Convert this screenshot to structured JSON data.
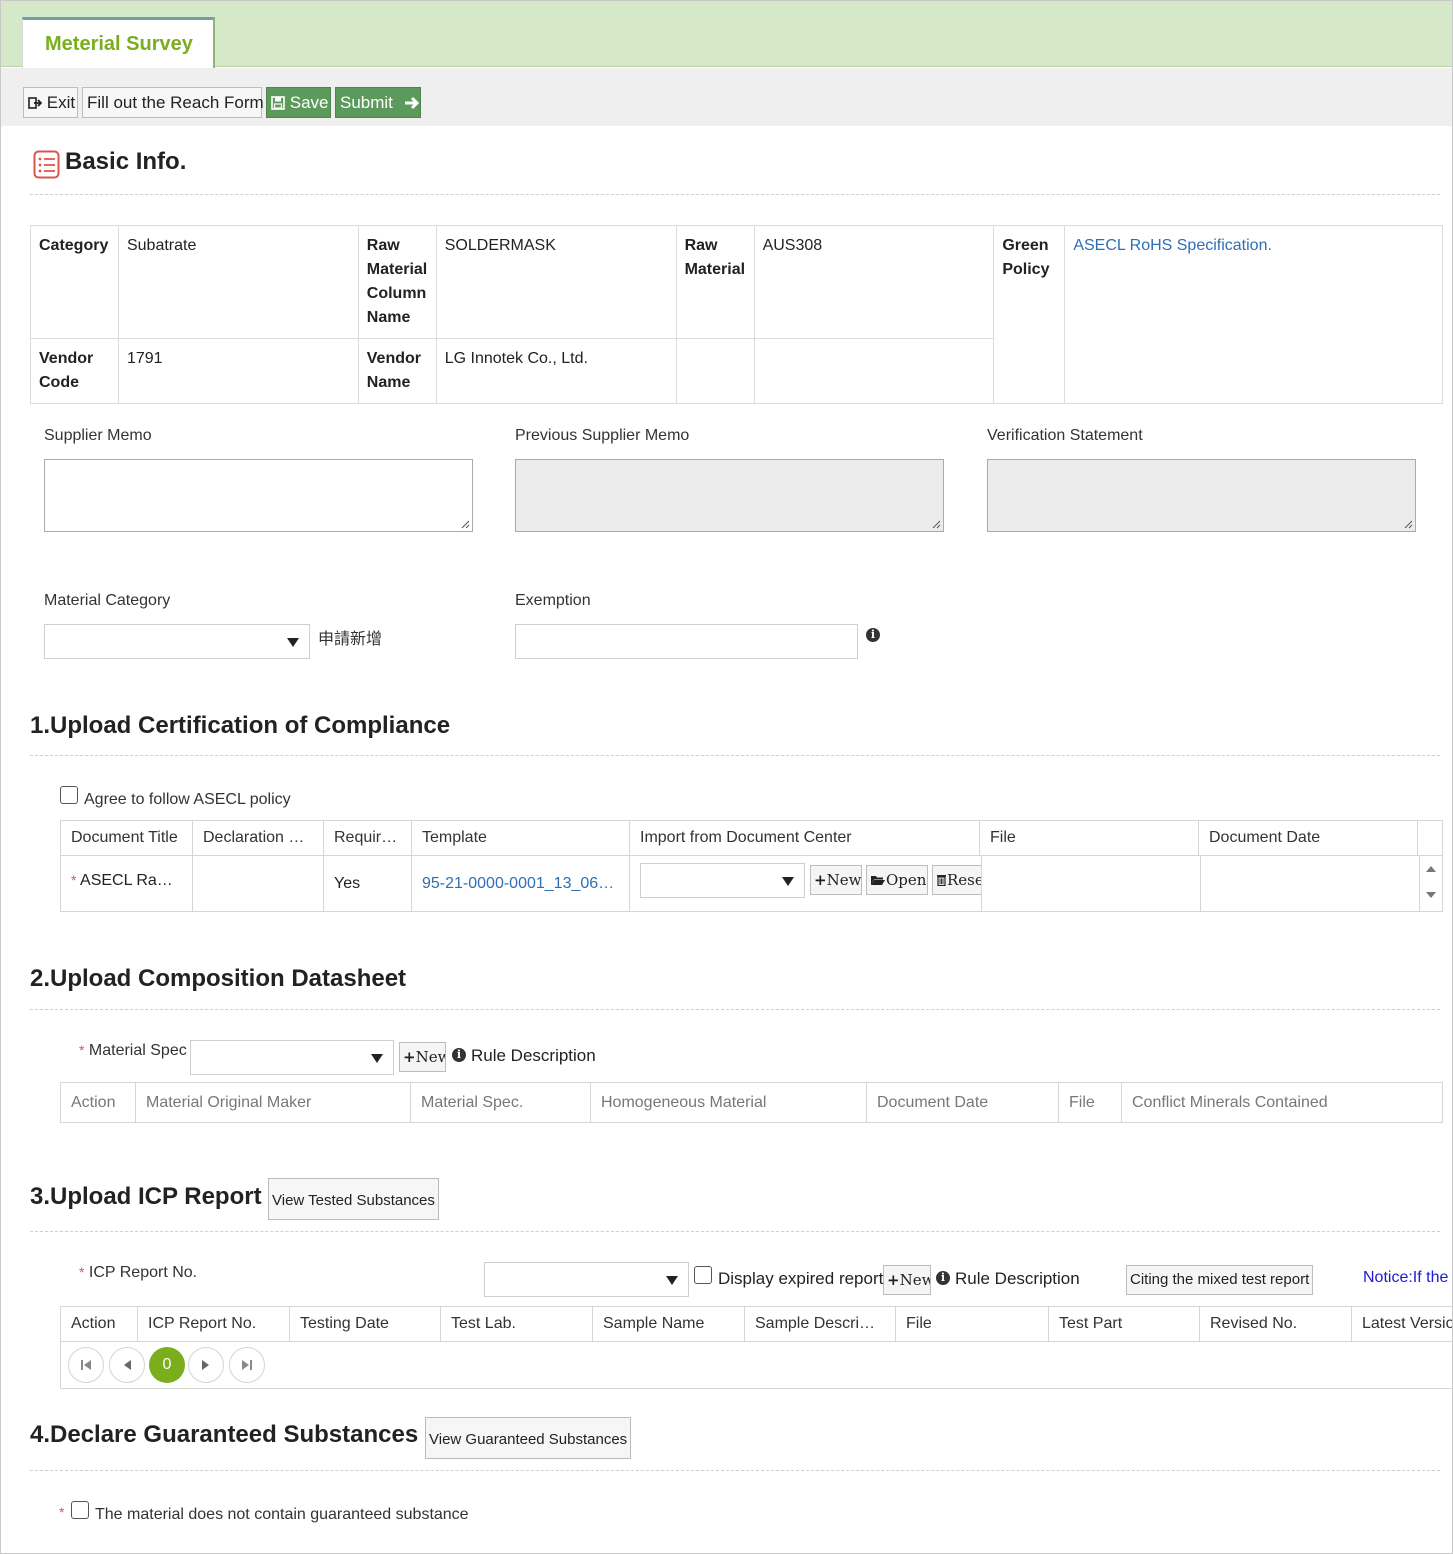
{
  "tab": {
    "label": "Meterial Survey"
  },
  "toolbar": {
    "exit": "Exit",
    "reach": "Fill out the Reach Form",
    "save": "Save",
    "submit": "Submit"
  },
  "basic": {
    "title": "Basic Info.",
    "category_label": "Category",
    "category_value": "Subatrate",
    "rmcn_label": "Raw Material Column Name",
    "rmcn_value": "SOLDERMASK",
    "rm_label": "Raw Material",
    "rm_value": "AUS308",
    "green_label": "Green Policy",
    "green_value": "ASECL RoHS Specification.",
    "vendor_code_label": "Vendor Code",
    "vendor_code_value": "1791",
    "vendor_name_label": "Vendor Name",
    "vendor_name_value": "LG Innotek Co., Ltd."
  },
  "memos": {
    "supplier": "Supplier Memo",
    "previous": "Previous Supplier Memo",
    "verification": "Verification Statement"
  },
  "material_category": {
    "label": "Material Category",
    "apply_link": "申請新增"
  },
  "exemption": {
    "label": "Exemption"
  },
  "sec1": {
    "title": "1.Upload Certification of Compliance",
    "agree": "Agree to follow ASECL policy",
    "headers": [
      "Document Title",
      "Declaration …",
      "Requir…",
      "Template",
      "Import from Document Center",
      "File",
      "Document Date"
    ],
    "row": {
      "title": "ASECL Ra…",
      "declaration": "",
      "required": "Yes",
      "template": "95-21-0000-0001_13_06…"
    },
    "btn_new": "New",
    "btn_open": "Open",
    "btn_reset": "Rese"
  },
  "sec2": {
    "title": "2.Upload Composition Datasheet",
    "spec_label": "Material Spec",
    "btn_new": "New",
    "rule": "Rule Description",
    "headers": [
      "Action",
      "Material Original Maker",
      "Material Spec.",
      "Homogeneous Material",
      "Document Date",
      "File",
      "Conflict Minerals Contained"
    ]
  },
  "sec3": {
    "title": "3.Upload ICP Report",
    "view_btn": "View Tested Substances",
    "report_label": "ICP Report No.",
    "expired": "Display expired report",
    "btn_new": "New",
    "rule": "Rule Description",
    "citing": "Citing the mixed test report",
    "notice": "Notice:If the",
    "headers": [
      "Action",
      "ICP Report No.",
      "Testing Date",
      "Test Lab.",
      "Sample Name",
      "Sample Descri…",
      "File",
      "Test Part",
      "Revised No.",
      "Latest Versio"
    ],
    "page": "0"
  },
  "sec4": {
    "title": "4.Declare Guaranteed Substances",
    "view_btn": "View Guaranteed Substances",
    "statement": "The material does not contain guaranteed substance"
  },
  "colors": {
    "accent": "#7bae1d",
    "topbar": "#d5e8c8",
    "save_green": "#5c9a5c",
    "link": "#2f6eb5"
  }
}
